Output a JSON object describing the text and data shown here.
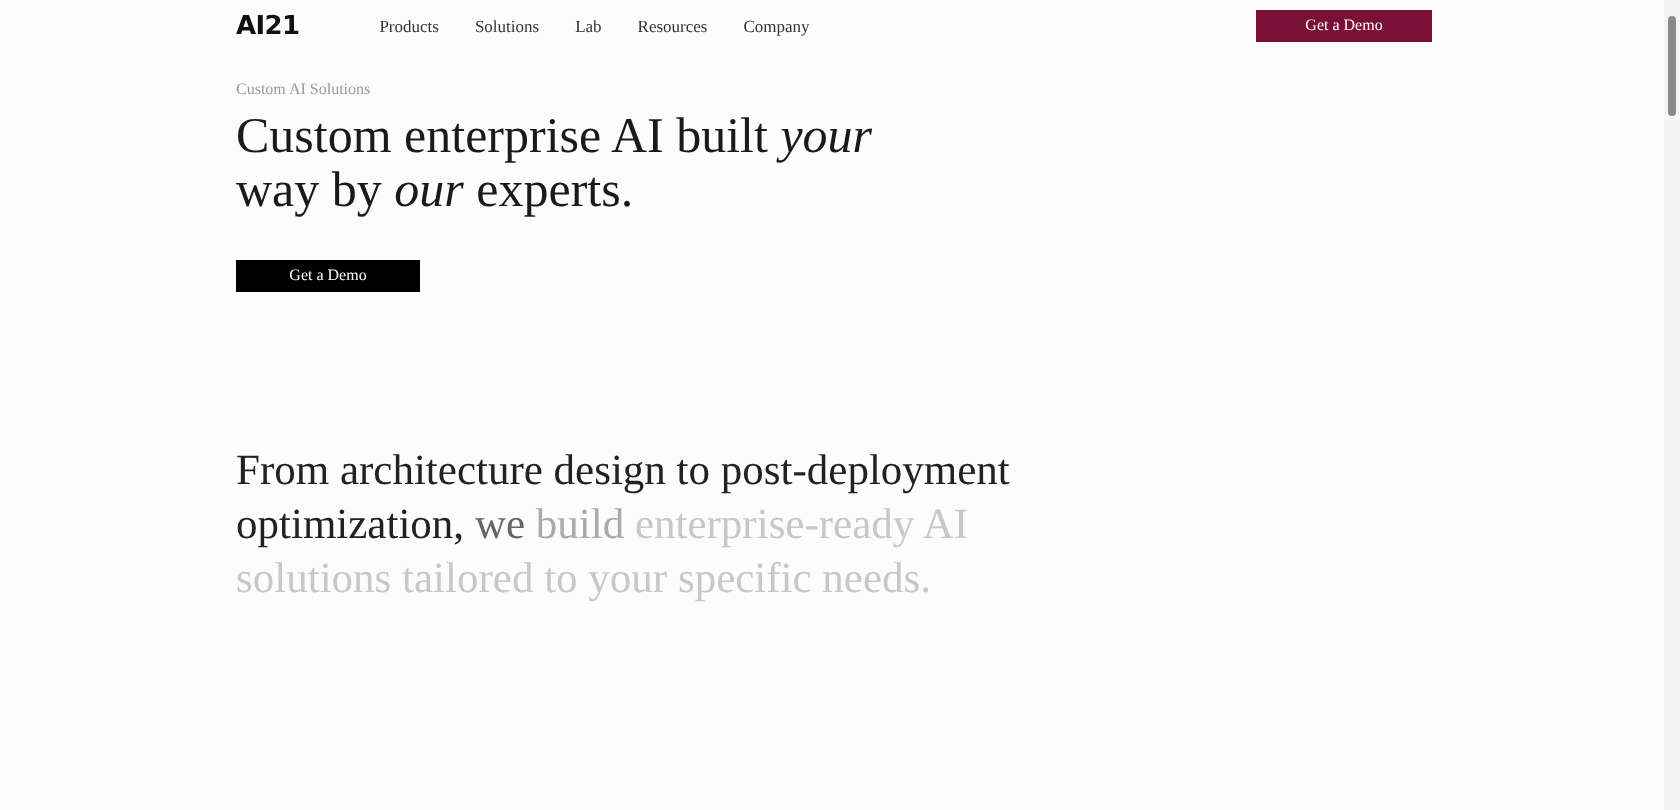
{
  "header": {
    "logo": "AI21",
    "nav": [
      "Products",
      "Solutions",
      "Lab",
      "Resources",
      "Company"
    ],
    "cta": "Get a Demo"
  },
  "hero": {
    "eyebrow": "Custom AI Solutions",
    "headline": "Custom enterprise AI built *your* way by *our* experts.",
    "cta": "Get a Demo"
  },
  "statement": {
    "segments": [
      {
        "text": "From architecture design to post-deployment optimization,",
        "kind": "revealed"
      },
      {
        "text": "we",
        "kind": "partial"
      },
      {
        "text": "build",
        "kind": "dim"
      },
      {
        "text": "enterprise-ready AI solutions tailored to your specific needs.",
        "kind": "faded"
      }
    ]
  }
}
